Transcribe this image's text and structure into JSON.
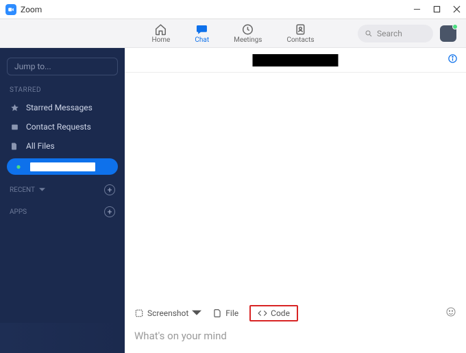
{
  "titlebar": {
    "app_name": "Zoom"
  },
  "nav": {
    "home": "Home",
    "chat": "Chat",
    "meetings": "Meetings",
    "contacts": "Contacts",
    "search_placeholder": "Search"
  },
  "sidebar": {
    "jump_to": "Jump to...",
    "starred_header": "STARRED",
    "items": {
      "starred_messages": "Starred Messages",
      "contact_requests": "Contact Requests",
      "all_files": "All Files"
    },
    "recent_header": "RECENT",
    "apps_header": "APPS"
  },
  "compose": {
    "screenshot": "Screenshot",
    "file": "File",
    "code": "Code",
    "placeholder": "What's on your mind"
  }
}
